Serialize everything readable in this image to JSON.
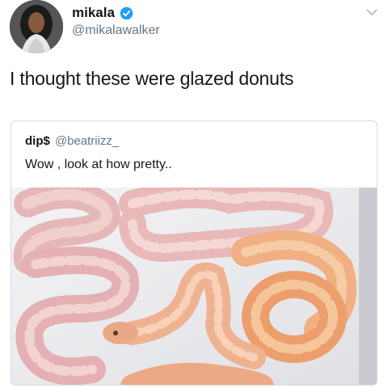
{
  "tweet": {
    "display_name": "mikala",
    "handle": "@mikalawalker",
    "text": "I thought these were glazed donuts",
    "verified_icon": "verified-badge-icon",
    "menu_icon": "chevron-down-icon"
  },
  "quoted_tweet": {
    "display_name": "dip$",
    "handle": "@beatriizz_",
    "text": "Wow , look at how pretty..",
    "image_subject": "pink and orange coiled snakes in a white tray"
  },
  "colors": {
    "verified_blue": "#1da1f2",
    "handle_gray": "#657786",
    "text_dark": "#14171a",
    "border": "#d6dde3"
  }
}
